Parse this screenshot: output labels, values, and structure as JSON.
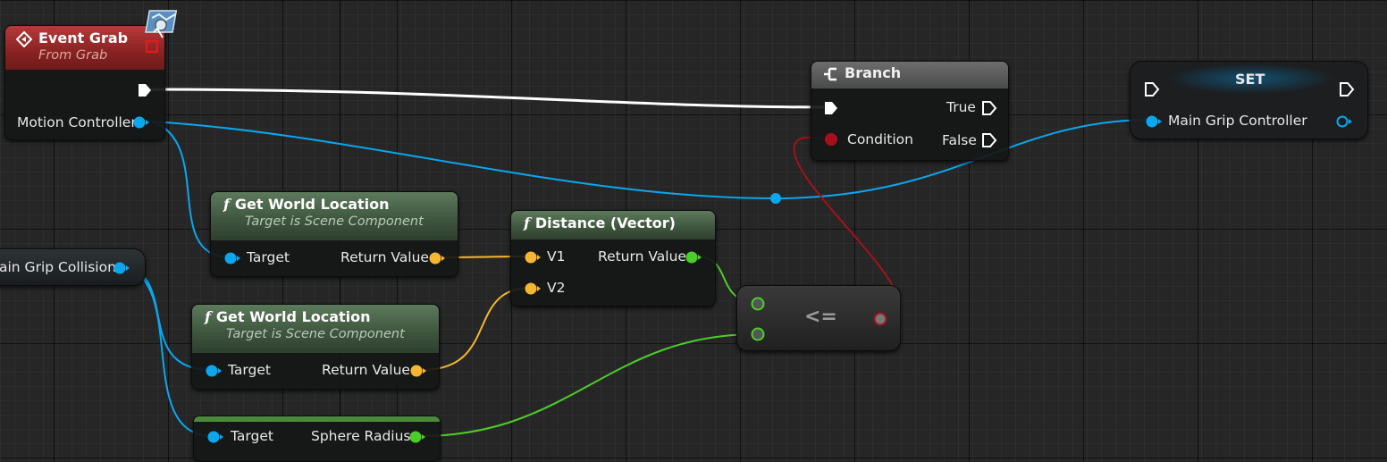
{
  "event_grab": {
    "title": "Event Grab",
    "subtitle": "From Grab",
    "output_label": "Motion Controller"
  },
  "branch": {
    "title": "Branch",
    "condition_label": "Condition",
    "true_label": "True",
    "false_label": "False"
  },
  "set_node": {
    "title": "SET",
    "var_label": "Main Grip Controller"
  },
  "get_world_location_1": {
    "title": "Get World Location",
    "subtitle": "Target is Scene Component",
    "input_label": "Target",
    "output_label": "Return Value"
  },
  "get_world_location_2": {
    "title": "Get World Location",
    "subtitle": "Target is Scene Component",
    "input_label": "Target",
    "output_label": "Return Value"
  },
  "distance": {
    "title": "Distance (Vector)",
    "v1_label": "V1",
    "v2_label": "V2",
    "output_label": "Return Value"
  },
  "compare": {
    "operator": "<="
  },
  "main_grip_collision": {
    "label": "ain Grip Collision"
  },
  "sphere_radius_node": {
    "input_label": "Target",
    "output_label": "Sphere Radius"
  },
  "icons": {
    "function": "f",
    "exec": "exec-pin-icon",
    "branch": "branch-icon",
    "event": "event-diamond-icon",
    "map": "gamepad-map-icon"
  },
  "colors": {
    "object_pin": "#0aa7f0",
    "vector_pin": "#f5b631",
    "float_pin": "#4ccd2a",
    "bool_pin": "#a5111b",
    "exec_wire": "#ffffff",
    "event_header": "#9b2a2a",
    "function_header": "#4b6a4b"
  }
}
